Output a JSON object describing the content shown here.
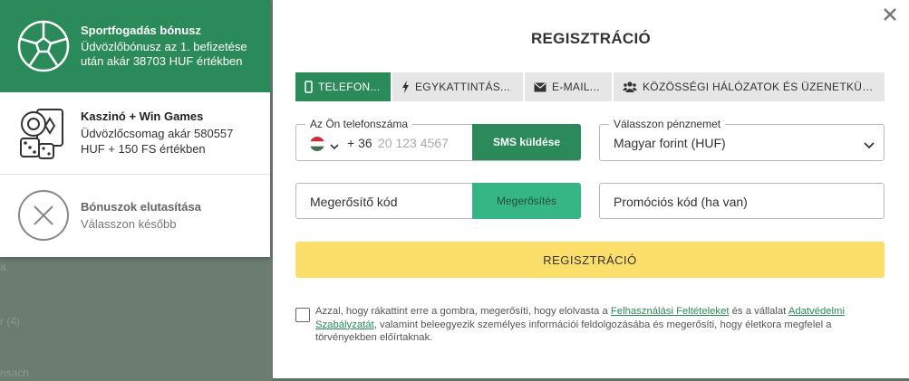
{
  "background": {
    "fragments": [
      "a",
      "r (4)",
      "nsach"
    ]
  },
  "bonus_panel": {
    "sport": {
      "title": "Sportfogadás bónusz",
      "description": "Üdvözlőbónusz az 1. befizetése után akár 38703 HUF értékben",
      "icon": "soccer-ball-icon"
    },
    "casino": {
      "title": "Kaszinó + Win Games",
      "description": "Üdvözlőcsomag akár 580557 HUF + 150 FS értékben",
      "icon": "casino-chips-cards-dice-icon"
    },
    "decline": {
      "title": "Bónuszok elutasítása",
      "description": "Válasszon később",
      "icon": "circle-x-icon"
    }
  },
  "modal": {
    "title": "REGISZTRÁCIÓ",
    "close_icon": "close-icon",
    "tabs": [
      {
        "label": "TELEFON...",
        "icon": "phone-icon",
        "active": true
      },
      {
        "label": "EGYKATTINTÁS...",
        "icon": "lightning-icon",
        "active": false
      },
      {
        "label": "E-MAIL...",
        "icon": "envelope-icon",
        "active": false
      },
      {
        "label": "KÖZÖSSÉGI HÁLÓZATOK ÉS ÜZENETKÜLD...",
        "icon": "users-icon",
        "active": false
      }
    ],
    "phone": {
      "legend": "Az Ön telefonszáma",
      "prefix": "+ 36",
      "placeholder": "20 123 4567",
      "value": "",
      "sms_button": "SMS küldése"
    },
    "currency": {
      "legend": "Válasszon pénznemet",
      "selected": "Magyar forint (HUF)"
    },
    "confirm_code": {
      "placeholder": "Megerősítő kód",
      "button": "Megerősítés"
    },
    "promo": {
      "placeholder": "Promóciós kód (ha van)"
    },
    "register_button": "REGISZTRÁCIÓ",
    "terms": {
      "checked": false,
      "text_before": "Azzal, hogy rákattint erre a gombra, megerősíti, hogy elolvasta a ",
      "link_terms": "Felhasználási Feltételeket",
      "text_middle": " és a vállalat ",
      "link_privacy": "Adatvédelmi Szabályzatát",
      "text_after": ", valamint beleegyezik személyes információi feldolgozásába és megerősíti, hogy életkora megfelel a törvényekben előírtaknak."
    }
  },
  "colors": {
    "primary_green": "#2b8a5a",
    "light_green": "#37b685",
    "yellow": "#fcdf6b",
    "tab_gray": "#e6e6e6"
  }
}
